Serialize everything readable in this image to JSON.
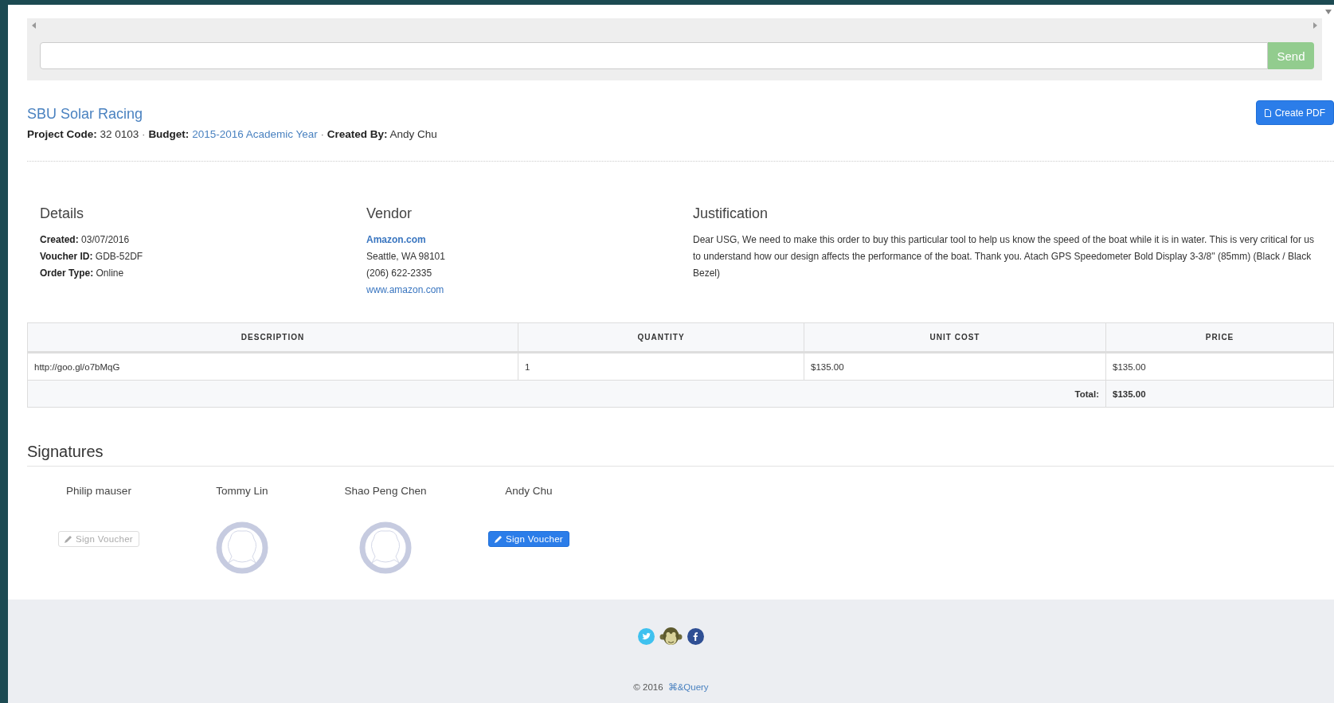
{
  "chat": {
    "send_label": "Send",
    "send_disabled": true
  },
  "project": {
    "title": "SBU Solar Racing",
    "pdf_label": "Create PDF",
    "meta": [
      {
        "label": "Project Code:",
        "value": "32 0103",
        "link": false,
        "separator": "·"
      },
      {
        "label": "Budget:",
        "value": "2015-2016 Academic Year",
        "link": true,
        "separator": "·"
      },
      {
        "label": "Created By:",
        "value": "Andy Chu",
        "link": false
      }
    ]
  },
  "details": {
    "heading": "Details",
    "fields": [
      {
        "label": "Created:",
        "value": "03/07/2016"
      },
      {
        "label": "Voucher ID:",
        "value": "GDB-52DF"
      },
      {
        "label": "Order Type:",
        "value": "Online"
      }
    ]
  },
  "vendor": {
    "heading": "Vendor",
    "lines": [
      {
        "kind": "name",
        "text": "Amazon.com"
      },
      {
        "kind": "text",
        "text": "Seattle, WA 98101"
      },
      {
        "kind": "text",
        "text": "(206) 622-2335"
      },
      {
        "kind": "link",
        "text": "www.amazon.com"
      }
    ]
  },
  "justification": {
    "heading": "Justification",
    "text": "Dear USG, We need to make this order to buy this particular tool to help us know the speed of the boat while it is in water. This is very critical for us to understand how our design affects the performance of the boat. Thank you. Atach GPS Speedometer Bold Display 3-3/8\" (85mm) (Black / Black Bezel)"
  },
  "table": {
    "columns": [
      "DESCRIPTION",
      "QUANTITY",
      "UNIT COST",
      "PRICE"
    ],
    "rows": [
      [
        "http://goo.gl/o7bMqG",
        "1",
        "$135.00",
        "$135.00"
      ]
    ],
    "total": {
      "label": "Total:",
      "value": "$135.00"
    }
  },
  "signatures": {
    "heading": "Signatures",
    "people": [
      {
        "name": "Philip mauser",
        "kind": "button",
        "label": "Sign Voucher",
        "disabled": true
      },
      {
        "name": "Tommy Lin",
        "kind": "avatar"
      },
      {
        "name": "Shao Peng Chen",
        "kind": "avatar"
      },
      {
        "name": "Andy Chu",
        "kind": "button",
        "label": "Sign Voucher",
        "disabled": false
      }
    ]
  },
  "footer": {
    "copyright": "© 2016",
    "brand": "⌘&Query"
  }
}
